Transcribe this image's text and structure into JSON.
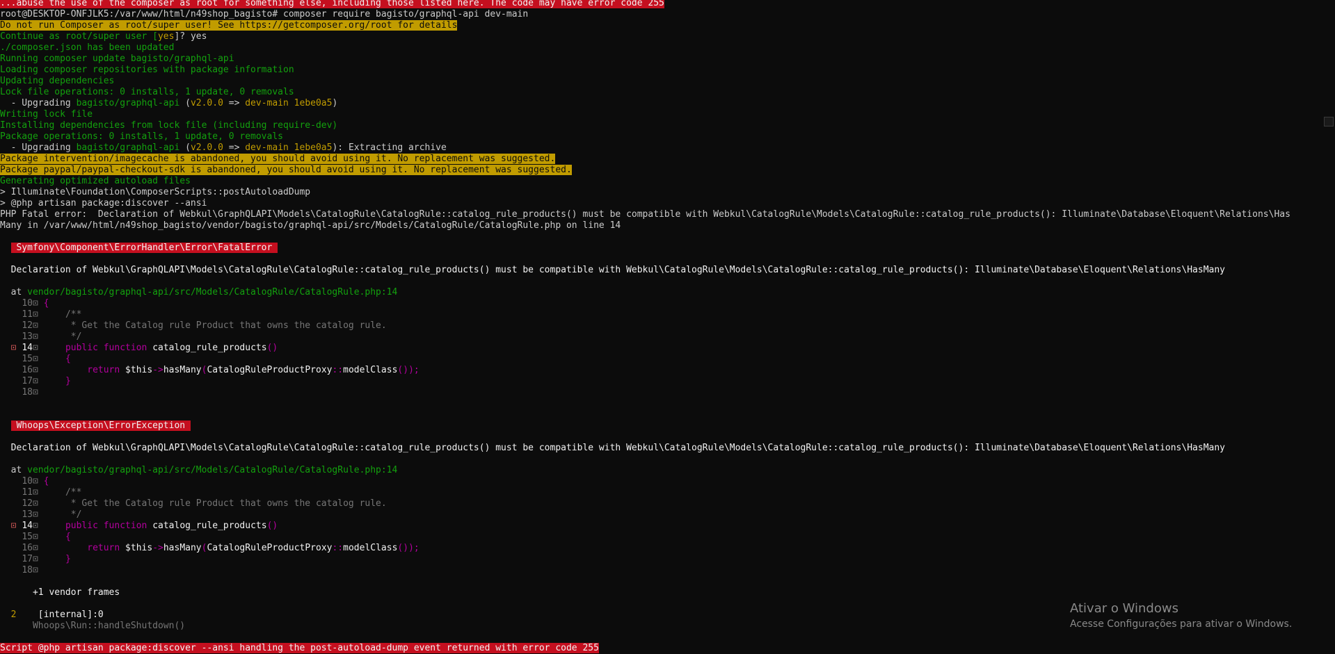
{
  "terminal": {
    "top_cutoff": "...abuse the use of the composer as root for something else, including those listed here. The code may have error code 255",
    "l_prompt": "root@DESKTOP-ONFJLK5:/var/www/html/n49shop_bagisto# composer require bagisto/graphql-api dev-main",
    "l_root_warning": "Do not run Composer as root/super user! See https://getcomposer.org/root for details",
    "l_continue_a": "Continue as root/super user [",
    "l_continue_b": "yes",
    "l_continue_c": "]? yes",
    "l_updated": "./composer.json has been updated",
    "l_running": "Running composer update bagisto/graphql-api",
    "l_loading": "Loading composer repositories with package information",
    "l_updating": "Updating dependencies",
    "l_lockops": "Lock file operations: 0 installs, 1 update, 0 removals",
    "l_up1_a": "  - Upgrading ",
    "l_up1_b": "bagisto/graphql-api",
    "l_up1_c": " (",
    "l_up1_d": "v2.0.0",
    "l_up1_e": " => ",
    "l_up1_f": "dev-main 1ebe0a5",
    "l_up1_g": ")",
    "l_writing": "Writing lock file",
    "l_installing": "Installing dependencies from lock file (including require-dev)",
    "l_pkgops": "Package operations: 0 installs, 1 update, 0 removals",
    "l_up2_g": "): Extracting archive",
    "l_abandon1": "Package intervention/imagecache is abandoned, you should avoid using it. No replacement was suggested.",
    "l_abandon2": "Package paypal/paypal-checkout-sdk is abandoned, you should avoid using it. No replacement was suggested.",
    "l_generating": "Generating optimized autoload files",
    "l_postautoload": "> Illuminate\\Foundation\\ComposerScripts::postAutoloadDump",
    "l_discover": "> @php artisan package:discover --ansi",
    "l_fatal1": "PHP Fatal error:  Declaration of Webkul\\GraphQLAPI\\Models\\CatalogRule\\CatalogRule::catalog_rule_products() must be compatible with Webkul\\CatalogRule\\Models\\CatalogRule::catalog_rule_products(): Illuminate\\Database\\Eloquent\\Relations\\Has",
    "l_fatal2": "Many in /var/www/html/n49shop_bagisto/vendor/bagisto/graphql-api/src/Models/CatalogRule/CatalogRule.php on line 14",
    "block1_badge": " Symfony\\Component\\ErrorHandler\\Error\\FatalError ",
    "block2_badge": " Whoops\\Exception\\ErrorException ",
    "decl": "  Declaration of Webkul\\GraphQLAPI\\Models\\CatalogRule\\CatalogRule::catalog_rule_products() must be compatible with Webkul\\CatalogRule\\Models\\CatalogRule::catalog_rule_products(): Illuminate\\Database\\Eloquent\\Relations\\HasMany",
    "at_a": "  at ",
    "at_path": "vendor/bagisto/graphql-api/src/Models/CatalogRule/CatalogRule.php",
    "at_line": ":14",
    "src": {
      "n10": "10",
      "n11": "11",
      "n12": "12",
      "n13": "13",
      "n14": "14",
      "n15": "15",
      "n16": "16",
      "n17": "17",
      "n18": "18",
      "box": "⊡",
      "arrow": "⊡",
      "brace_open": "{",
      "brace_close": "}",
      "c_open": "/**",
      "c_text": " * Get the Catalog rule Product that owns the catalog rule.",
      "c_close": " */",
      "kw_public": "public",
      "kw_function": "function",
      "fn_name": "catalog_rule_products",
      "parens": "()",
      "kw_return": "return",
      "this": "$this",
      "arrow_op": "->",
      "has_many": "hasMany",
      "paren_open": "(",
      "proxy": "CatalogRuleProductProxy",
      "dcolon": "::",
      "model_class": "modelClass",
      "tail": "());"
    },
    "vendor_frames": "      +1 vendor frames",
    "frame_num": "  2",
    "frame_internal": "[internal]:0",
    "frame_shutdown": "Whoops\\Run::handleShutdown()",
    "l_final": "Script @php artisan package:discover --ansi handling the post-autoload-dump event returned with error code 255"
  },
  "watermark": {
    "title": "Ativar o Windows",
    "subtitle": "Acesse Configurações para ativar o Windows."
  },
  "colors": {
    "background": "#0c0c0c",
    "green": "#13a10e",
    "yellow": "#c19c00",
    "red_badge": "#c50f1f",
    "magenta": "#b4009e"
  }
}
